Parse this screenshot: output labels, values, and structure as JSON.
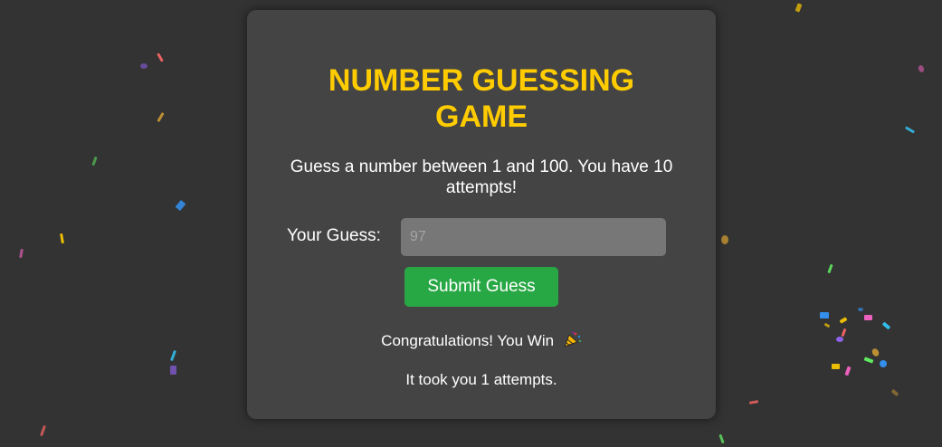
{
  "game": {
    "title": "NUMBER GUESSING GAME",
    "instructions": "Guess a number between 1 and 100. You have 10 attempts!",
    "guess_label": "Your Guess:",
    "guess_placeholder": "97",
    "submit_label": "Submit Guess",
    "result_message": "Congratulations! You Win",
    "result_icon": "party-popper-icon",
    "attempts_message": "It took you 1 attempts."
  },
  "colors": {
    "background": "#333333",
    "card": "#444444",
    "title": "#ffcc00",
    "submit_button": "#28a745",
    "input": "#777777"
  },
  "confetti_colors": [
    "#ffcc00",
    "#ff66cc",
    "#33ccff",
    "#9966ff",
    "#ff6666",
    "#cc9933",
    "#66ff66",
    "#3399ff"
  ]
}
